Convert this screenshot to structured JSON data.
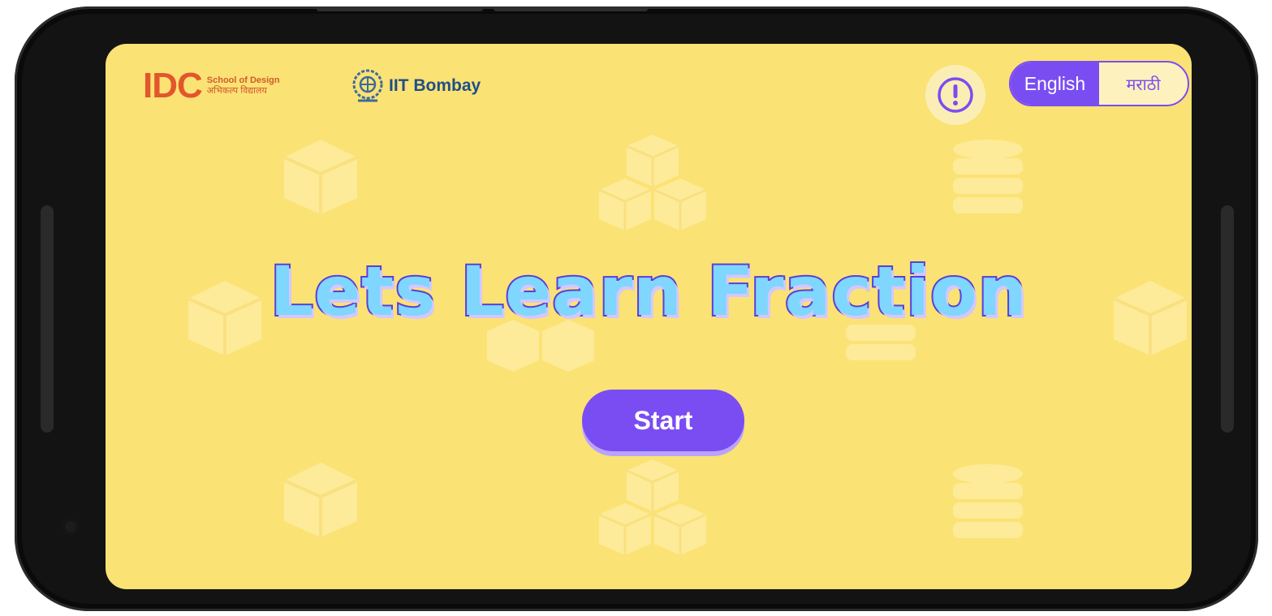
{
  "screen": {
    "title": "Lets Learn Fraction",
    "start_label": "Start"
  },
  "logos": {
    "idc_mark": "IDC",
    "idc_line1": "School of Design",
    "idc_line2": "अभिकल्प विद्यालय",
    "iitb_name": "IIT Bombay"
  },
  "language_toggle": {
    "options": [
      "English",
      "मराठी"
    ],
    "selected": "English"
  },
  "icons": {
    "info": "exclamation-info-icon",
    "background": [
      "cube-icon",
      "stacked-cubes-icon",
      "coin-stack-icon"
    ]
  },
  "colors": {
    "background": "#fbe274",
    "accent": "#7a4df2",
    "title_fill": "#7fd6ff",
    "title_outline": "#5b3ed8",
    "idc": "#e2562c",
    "iitb": "#1f4f88"
  }
}
